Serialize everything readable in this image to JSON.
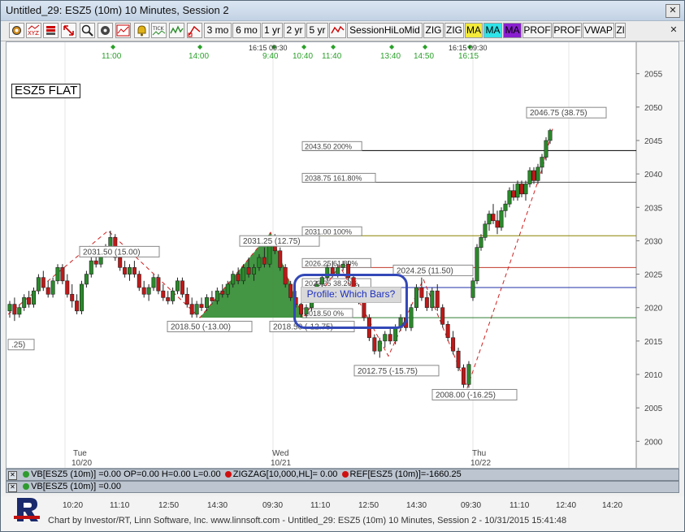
{
  "window": {
    "title": "Untitled_29: ESZ5 (10m) 10 Minutes, Session 2",
    "close_glyph": "✕"
  },
  "toolbar": {
    "icons": [
      "chart-settings-icon",
      "xyz-icon",
      "stack-icon",
      "resize-icon",
      "zoom-icon",
      "gear-icon",
      "price-chart-icon",
      "alert-bell-icon",
      "tick-icon",
      "wave-icon",
      "line-icon",
      "trend-icon"
    ],
    "buttons": [
      "3 mo",
      "6 mo",
      "1 yr",
      "2 yr",
      "5 yr",
      "",
      "SessionHiLoMid",
      "ZIG",
      "ZIG",
      "MA",
      "MA",
      "MA",
      "PROF",
      "PROF",
      "VWAP",
      "Zl"
    ],
    "close_glyph": "✕"
  },
  "symbol_label": "ESZ5 FLAT",
  "profile_callout": "Profile: Which Bars?",
  "chart_data": {
    "type": "candlestick",
    "ylim": [
      1997,
      2058
    ],
    "y_ticks": [
      "2055",
      "2050",
      "2045",
      "2040",
      "2035",
      "2030",
      "2025",
      "2020",
      "2015",
      "2010",
      "2005",
      "2000"
    ],
    "x_ticks": [
      "10:20",
      "11:10",
      "12:50",
      "14:30",
      "09:30",
      "11:10",
      "12:50",
      "14:30",
      "09:30",
      "11:10",
      "12:40",
      "14:20"
    ],
    "day_labels": [
      {
        "day": "Tue",
        "date": "10/20"
      },
      {
        "day": "Wed",
        "date": "10/21"
      },
      {
        "day": "Thu",
        "date": "10/22"
      }
    ],
    "top_time_markers": [
      "11:00",
      "14:00",
      "9:40",
      "10:40",
      "11:40",
      "13:40",
      "14:50",
      "16:15"
    ],
    "top_session_labels": [
      "16:15 09:30",
      "16:15 09:30"
    ],
    "fib_levels": [
      {
        "label": "2043.50 200%",
        "value": 2043.5,
        "color": "#000000"
      },
      {
        "label": "2038.75 161.80%",
        "value": 2038.75,
        "color": "#555555"
      },
      {
        "label": "2031.00 100%",
        "value": 2030.75,
        "color": "#8b8000"
      },
      {
        "label": "2026.25 61.80%",
        "value": 2026.0,
        "color": "#c0392b"
      },
      {
        "label": "2023.25 38.20%",
        "value": 2023.0,
        "color": "#1f2fa8"
      },
      {
        "label": "2018.50 0%",
        "value": 2018.5,
        "color": "#2e7d32"
      }
    ],
    "zigzag_labels": [
      "2031.50 (15.00)",
      "2018.50 (-13.00)",
      "2031.25 (12.75)",
      "2018.50 (-12.75)",
      "2024.25 (11.50)",
      "2012.75 (-15.75)",
      "2008.00 (-16.25)",
      "2046.75 (38.75)",
      ".25)"
    ],
    "candles": [
      [
        2019.5,
        2021.0,
        2018.5,
        2020.5
      ],
      [
        2020.5,
        2021.5,
        2018.0,
        2019.0
      ],
      [
        2019.0,
        2020.5,
        2018.5,
        2020.0
      ],
      [
        2020.0,
        2022.0,
        2019.5,
        2021.5
      ],
      [
        2021.5,
        2022.5,
        2020.0,
        2020.5
      ],
      [
        2020.5,
        2023.0,
        2020.0,
        2022.5
      ],
      [
        2022.5,
        2025.0,
        2022.0,
        2024.5
      ],
      [
        2024.5,
        2025.5,
        2022.5,
        2023.0
      ],
      [
        2023.0,
        2024.0,
        2021.5,
        2022.0
      ],
      [
        2022.0,
        2024.5,
        2021.5,
        2024.0
      ],
      [
        2024.0,
        2026.5,
        2023.5,
        2026.0
      ],
      [
        2026.0,
        2026.5,
        2023.5,
        2024.0
      ],
      [
        2024.0,
        2025.0,
        2021.5,
        2022.0
      ],
      [
        2022.0,
        2023.5,
        2020.0,
        2021.0
      ],
      [
        2021.0,
        2022.0,
        2019.0,
        2019.5
      ],
      [
        2019.5,
        2024.0,
        2019.0,
        2023.5
      ],
      [
        2023.5,
        2025.5,
        2023.0,
        2025.0
      ],
      [
        2025.0,
        2027.5,
        2024.5,
        2027.0
      ],
      [
        2027.0,
        2028.5,
        2026.0,
        2026.5
      ],
      [
        2026.5,
        2029.0,
        2026.0,
        2028.5
      ],
      [
        2028.5,
        2029.5,
        2027.5,
        2029.0
      ],
      [
        2029.0,
        2031.5,
        2028.5,
        2030.5
      ],
      [
        2030.5,
        2031.0,
        2027.0,
        2027.5
      ],
      [
        2027.5,
        2028.5,
        2025.5,
        2026.0
      ],
      [
        2026.0,
        2027.0,
        2024.5,
        2025.0
      ],
      [
        2025.0,
        2026.5,
        2024.0,
        2026.0
      ],
      [
        2026.0,
        2027.0,
        2024.5,
        2025.0
      ],
      [
        2025.0,
        2025.5,
        2022.5,
        2023.0
      ],
      [
        2023.0,
        2024.0,
        2021.5,
        2022.0
      ],
      [
        2022.0,
        2023.5,
        2021.0,
        2023.0
      ],
      [
        2023.0,
        2025.0,
        2022.5,
        2024.5
      ],
      [
        2024.5,
        2025.0,
        2022.0,
        2022.5
      ],
      [
        2022.5,
        2023.5,
        2021.0,
        2021.5
      ],
      [
        2021.5,
        2022.5,
        2020.5,
        2021.0
      ],
      [
        2021.0,
        2023.0,
        2020.5,
        2022.5
      ],
      [
        2022.5,
        2024.5,
        2022.0,
        2024.0
      ],
      [
        2024.0,
        2024.5,
        2021.5,
        2022.0
      ],
      [
        2022.0,
        2023.0,
        2020.0,
        2020.5
      ],
      [
        2020.5,
        2021.5,
        2018.5,
        2019.0
      ],
      [
        2019.0,
        2021.0,
        2018.5,
        2020.5
      ],
      [
        2020.5,
        2021.5,
        2019.5,
        2020.0
      ],
      [
        2020.0,
        2022.0,
        2019.5,
        2021.5
      ],
      [
        2021.5,
        2022.5,
        2020.5,
        2021.0
      ],
      [
        2021.0,
        2023.0,
        2020.5,
        2022.5
      ],
      [
        2022.5,
        2023.5,
        2021.5,
        2022.0
      ],
      [
        2022.0,
        2024.0,
        2021.5,
        2023.5
      ],
      [
        2023.5,
        2025.5,
        2023.0,
        2025.0
      ],
      [
        2025.0,
        2026.0,
        2023.5,
        2024.0
      ],
      [
        2024.0,
        2026.5,
        2023.5,
        2026.0
      ],
      [
        2026.0,
        2027.5,
        2024.5,
        2025.0
      ],
      [
        2025.0,
        2026.5,
        2024.0,
        2026.0
      ],
      [
        2026.0,
        2028.0,
        2025.5,
        2027.5
      ],
      [
        2027.5,
        2029.0,
        2026.0,
        2026.5
      ],
      [
        2026.5,
        2030.5,
        2026.0,
        2030.0
      ],
      [
        2030.0,
        2031.0,
        2028.0,
        2028.5
      ],
      [
        2028.5,
        2029.0,
        2025.5,
        2026.0
      ],
      [
        2026.0,
        2026.5,
        2023.0,
        2023.5
      ],
      [
        2023.5,
        2024.0,
        2021.0,
        2021.5
      ],
      [
        2021.5,
        2022.5,
        2020.0,
        2020.5
      ],
      [
        2020.5,
        2021.5,
        2018.5,
        2019.0
      ],
      [
        2019.0,
        2020.5,
        2018.5,
        2020.0
      ],
      [
        2020.0,
        2022.5,
        2019.5,
        2022.0
      ],
      [
        2022.0,
        2024.0,
        2021.5,
        2023.5
      ],
      [
        2023.5,
        2025.0,
        2023.0,
        2024.5
      ],
      [
        2024.5,
        2026.5,
        2024.0,
        2026.0
      ],
      [
        2026.0,
        2027.0,
        2024.5,
        2025.0
      ],
      [
        2025.0,
        2026.5,
        2024.5,
        2026.0
      ],
      [
        2026.0,
        2027.0,
        2025.5,
        2026.5
      ],
      [
        2026.5,
        2027.0,
        2024.0,
        2024.5
      ],
      [
        2024.5,
        2025.0,
        2022.5,
        2023.0
      ],
      [
        2023.0,
        2023.5,
        2020.5,
        2021.0
      ],
      [
        2021.0,
        2021.5,
        2018.0,
        2018.5
      ],
      [
        2018.5,
        2019.0,
        2015.0,
        2015.5
      ],
      [
        2015.5,
        2016.0,
        2013.0,
        2013.5
      ],
      [
        2013.5,
        2015.5,
        2012.5,
        2015.0
      ],
      [
        2015.0,
        2016.5,
        2014.0,
        2016.0
      ],
      [
        2016.0,
        2017.0,
        2014.5,
        2015.0
      ],
      [
        2015.0,
        2017.5,
        2014.5,
        2017.0
      ],
      [
        2017.0,
        2019.0,
        2016.5,
        2018.5
      ],
      [
        2018.5,
        2019.5,
        2016.5,
        2017.0
      ],
      [
        2017.0,
        2020.5,
        2016.5,
        2020.0
      ],
      [
        2020.0,
        2023.5,
        2019.5,
        2023.0
      ],
      [
        2023.0,
        2024.5,
        2021.0,
        2021.5
      ],
      [
        2021.5,
        2022.5,
        2019.5,
        2020.0
      ],
      [
        2020.0,
        2023.0,
        2019.5,
        2022.5
      ],
      [
        2022.5,
        2023.5,
        2019.5,
        2020.0
      ],
      [
        2020.0,
        2020.5,
        2017.0,
        2017.5
      ],
      [
        2017.5,
        2018.0,
        2015.0,
        2015.5
      ],
      [
        2015.5,
        2016.5,
        2013.0,
        2013.5
      ],
      [
        2013.5,
        2014.0,
        2010.5,
        2011.0
      ],
      [
        2011.0,
        2011.5,
        2008.0,
        2008.5
      ],
      [
        2008.5,
        2012.0,
        2008.0,
        2011.5
      ],
      [
        2021.5,
        2024.5,
        2021.0,
        2024.0
      ],
      [
        2024.0,
        2029.5,
        2023.5,
        2029.0
      ],
      [
        2029.0,
        2031.0,
        2028.5,
        2030.5
      ],
      [
        2030.5,
        2033.0,
        2030.0,
        2032.5
      ],
      [
        2032.5,
        2034.5,
        2031.5,
        2034.0
      ],
      [
        2034.0,
        2035.5,
        2032.5,
        2033.0
      ],
      [
        2033.0,
        2034.5,
        2031.0,
        2032.0
      ],
      [
        2032.0,
        2035.0,
        2031.5,
        2034.5
      ],
      [
        2034.5,
        2036.0,
        2033.5,
        2035.5
      ],
      [
        2035.5,
        2038.0,
        2035.0,
        2037.5
      ],
      [
        2037.5,
        2038.5,
        2036.0,
        2036.5
      ],
      [
        2036.5,
        2039.0,
        2036.0,
        2038.5
      ],
      [
        2038.5,
        2039.0,
        2036.5,
        2037.0
      ],
      [
        2037.0,
        2039.0,
        2036.0,
        2038.5
      ],
      [
        2038.5,
        2041.0,
        2038.0,
        2040.5
      ],
      [
        2040.5,
        2041.0,
        2038.5,
        2039.0
      ],
      [
        2039.0,
        2041.5,
        2038.5,
        2041.0
      ],
      [
        2041.0,
        2043.0,
        2040.0,
        2042.5
      ],
      [
        2042.5,
        2045.5,
        2042.0,
        2045.0
      ],
      [
        2045.0,
        2046.75,
        2044.5,
        2046.5
      ]
    ]
  },
  "indicator_strips": [
    [
      {
        "text": "VB[ESZ5 (10m)] =0.00 OP=0.00 H=0.00 L=0.00",
        "dot": "#2e9b2e"
      },
      {
        "text": "ZIGZAG[10,000,HL]= 0.00",
        "dot": "#d01010"
      },
      {
        "text": "REF[ESZ5 (10m)]=-1660.25",
        "dot": "#d01010"
      }
    ],
    [
      {
        "text": "VB[ESZ5 (10m)] =0.00",
        "dot": "#2e9b2e"
      }
    ]
  ],
  "footer": {
    "credit": "Chart by Investor/RT, Linn Software, Inc. www.linnsoft.com - Untitled_29: ESZ5 (10m) 10 Minutes, Session 2 - 10/31/2015 15:41:48"
  }
}
